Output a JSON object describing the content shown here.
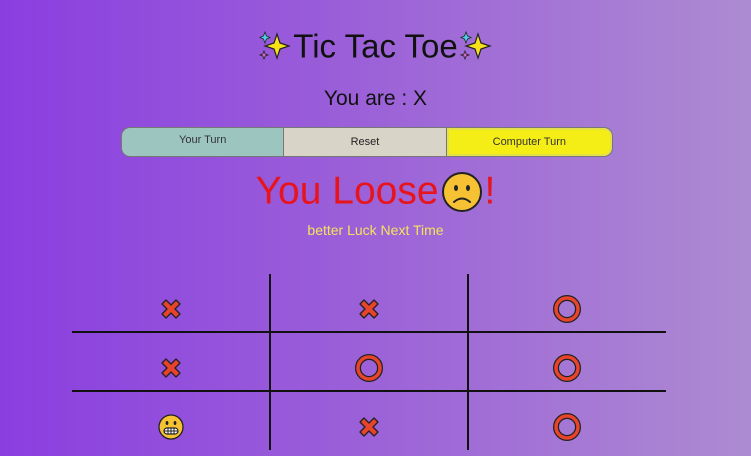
{
  "header": {
    "title": "Tic Tac Toe",
    "title_icon": "sparkles-icon",
    "player_label": "You are : X"
  },
  "status": {
    "your_turn": "Your Turn",
    "reset": "Reset",
    "computer_turn": "Computer Turn",
    "active": "computer"
  },
  "result": {
    "text": "You Loose",
    "emoji": "slightly-frowning-face-icon",
    "suffix": "!",
    "subtitle": "better Luck Next Time"
  },
  "board": {
    "cells": [
      "X",
      "X",
      "O",
      "X",
      "O",
      "O",
      "grimace",
      "X",
      "O"
    ]
  },
  "colors": {
    "x_mark": "#e8442b",
    "o_mark": "#e8442b",
    "result": "#e8141c",
    "subtitle": "#f6e35c",
    "computer_turn_bg": "#f5ee16"
  }
}
